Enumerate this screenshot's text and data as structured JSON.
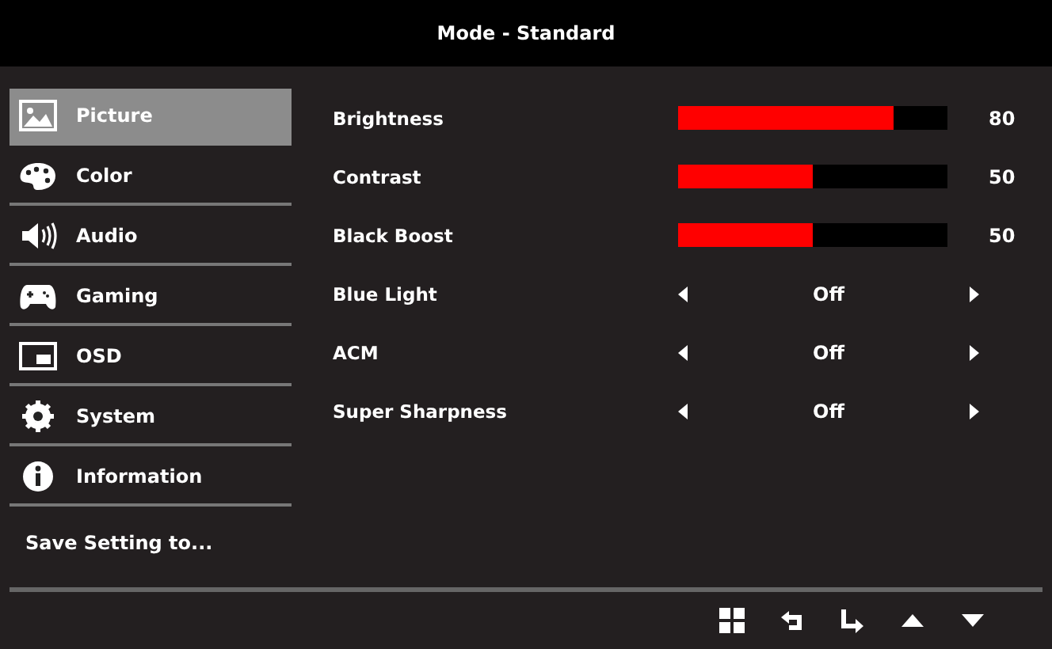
{
  "header": {
    "title": "Mode - Standard"
  },
  "sidebar": {
    "items": [
      {
        "label": "Picture",
        "selected": true
      },
      {
        "label": "Color",
        "selected": false
      },
      {
        "label": "Audio",
        "selected": false
      },
      {
        "label": "Gaming",
        "selected": false
      },
      {
        "label": "OSD",
        "selected": false
      },
      {
        "label": "System",
        "selected": false
      },
      {
        "label": "Information",
        "selected": false
      }
    ],
    "save_setting": "Save Setting to..."
  },
  "settings": [
    {
      "kind": "slider",
      "label": "Brightness",
      "level": 0.8,
      "reading": "80"
    },
    {
      "kind": "slider",
      "label": "Contrast",
      "level": 0.5,
      "reading": "50"
    },
    {
      "kind": "slider",
      "label": "Black Boost",
      "level": 0.5,
      "reading": "50"
    },
    {
      "kind": "option",
      "label": "Blue Light",
      "value": "Off"
    },
    {
      "kind": "option",
      "label": "ACM",
      "value": "Off"
    },
    {
      "kind": "option",
      "label": "Super Sharpness",
      "value": "Off"
    }
  ]
}
